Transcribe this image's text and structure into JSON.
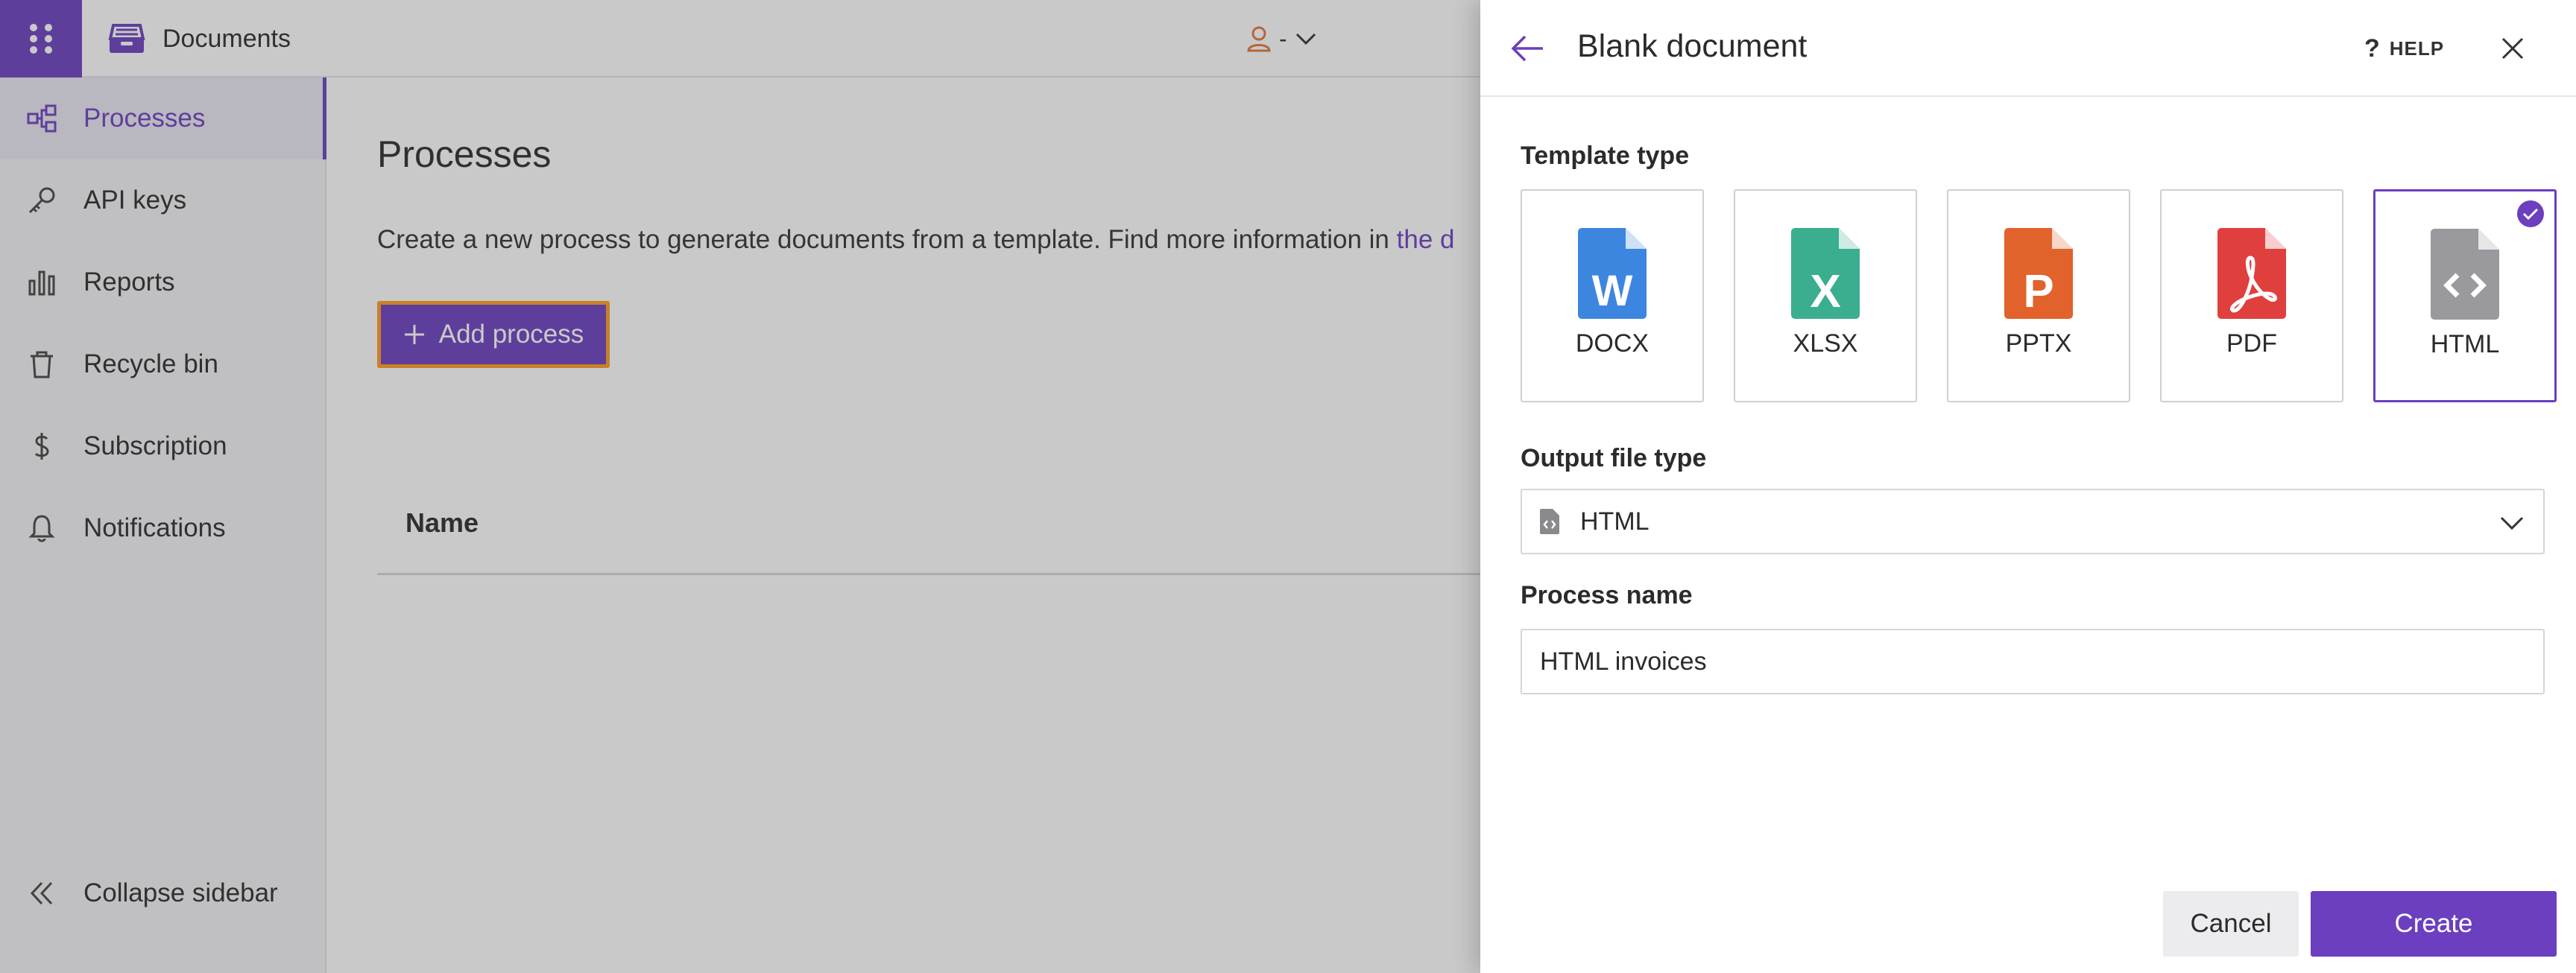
{
  "app": {
    "title": "Documents",
    "user_label": "-"
  },
  "sidebar": {
    "items": [
      {
        "label": "Processes",
        "icon": "processes-icon",
        "active": true
      },
      {
        "label": "API keys",
        "icon": "key-icon"
      },
      {
        "label": "Reports",
        "icon": "bar-chart-icon"
      },
      {
        "label": "Recycle bin",
        "icon": "trash-icon"
      },
      {
        "label": "Subscription",
        "icon": "dollar-icon"
      },
      {
        "label": "Notifications",
        "icon": "bell-icon"
      }
    ],
    "collapse_label": "Collapse sidebar"
  },
  "main": {
    "title": "Processes",
    "description": "Create a new process to generate documents from a template. Find more information in ",
    "description_link": "the d",
    "add_button_label": "Add process",
    "table_header_name": "Name"
  },
  "panel": {
    "title": "Blank document",
    "help_label": "HELP",
    "template_type_label": "Template type",
    "templates": [
      {
        "label": "DOCX",
        "letter": "W",
        "color": "#3d86e0",
        "icon": "docx-file-icon"
      },
      {
        "label": "XLSX",
        "letter": "X",
        "color": "#3aae8f",
        "icon": "xlsx-file-icon"
      },
      {
        "label": "PPTX",
        "letter": "P",
        "color": "#e2622b",
        "icon": "pptx-file-icon"
      },
      {
        "label": "PDF",
        "letter": "",
        "color": "#e0403d",
        "icon": "pdf-file-icon"
      },
      {
        "label": "HTML",
        "letter": "</>",
        "color": "#9a9a9e",
        "icon": "html-file-icon",
        "selected": true
      }
    ],
    "output_type_label": "Output file type",
    "output_type_value": "HTML",
    "process_name_label": "Process name",
    "process_name_value": "HTML invoices",
    "cancel_label": "Cancel",
    "create_label": "Create"
  },
  "colors": {
    "accent": "#6b3fbf",
    "focus_outline": "#ff9b21"
  }
}
